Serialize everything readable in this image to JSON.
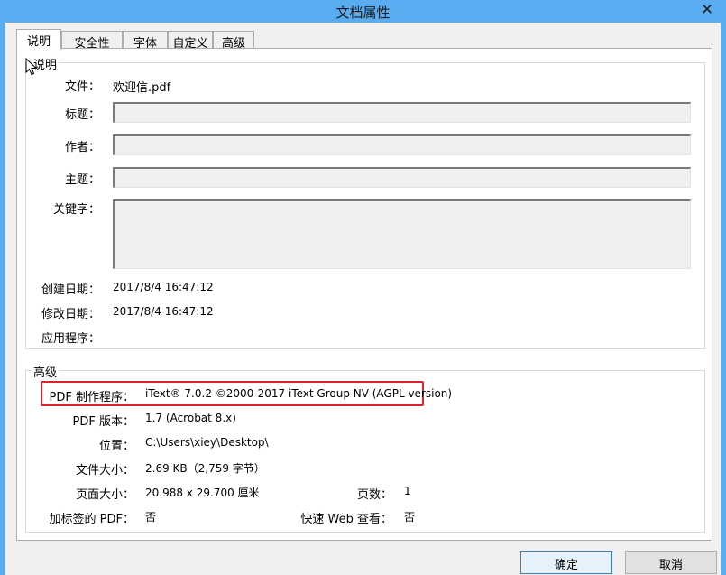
{
  "window": {
    "title": "文档属性",
    "close_glyph": "✕"
  },
  "tabs": [
    {
      "label": "说明",
      "active": true
    },
    {
      "label": "安全性"
    },
    {
      "label": "字体"
    },
    {
      "label": "自定义"
    },
    {
      "label": "高级"
    }
  ],
  "description": {
    "group_title": "说明",
    "file_label": "文件：",
    "file_value": "欢迎信.pdf",
    "title_label": "标题：",
    "title_value": "",
    "author_label": "作者：",
    "author_value": "",
    "subject_label": "主题：",
    "subject_value": "",
    "keywords_label": "关键字：",
    "keywords_value": "",
    "created_label": "创建日期：",
    "created_value": "2017/8/4 16:47:12",
    "modified_label": "修改日期：",
    "modified_value": "2017/8/4 16:47:12",
    "app_label": "应用程序：",
    "app_value": ""
  },
  "advanced": {
    "group_title": "高级",
    "producer_label": "PDF 制作程序：",
    "producer_value": "iText® 7.0.2 ©2000-2017 iText Group NV (AGPL-version)",
    "version_label": "PDF 版本：",
    "version_value": "1.7 (Acrobat 8.x)",
    "location_label": "位置：",
    "location_value": "C:\\Users\\xiey\\Desktop\\",
    "filesize_label": "文件大小：",
    "filesize_value": "2.69 KB（2,759 字节）",
    "pagesize_label": "页面大小：",
    "pagesize_value": "20.988 x 29.700 厘米",
    "pages_label": "页数：",
    "pages_value": "1",
    "tagged_label": "加标签的 PDF：",
    "tagged_value": "否",
    "fastweb_label": "快速 Web 查看：",
    "fastweb_value": "否"
  },
  "buttons": {
    "ok": "确定",
    "cancel": "取消"
  },
  "colors": {
    "titlebar": "#5aacf0",
    "highlight": "#d9252b"
  },
  "icons": [
    "close-icon",
    "mouse-cursor-icon"
  ]
}
